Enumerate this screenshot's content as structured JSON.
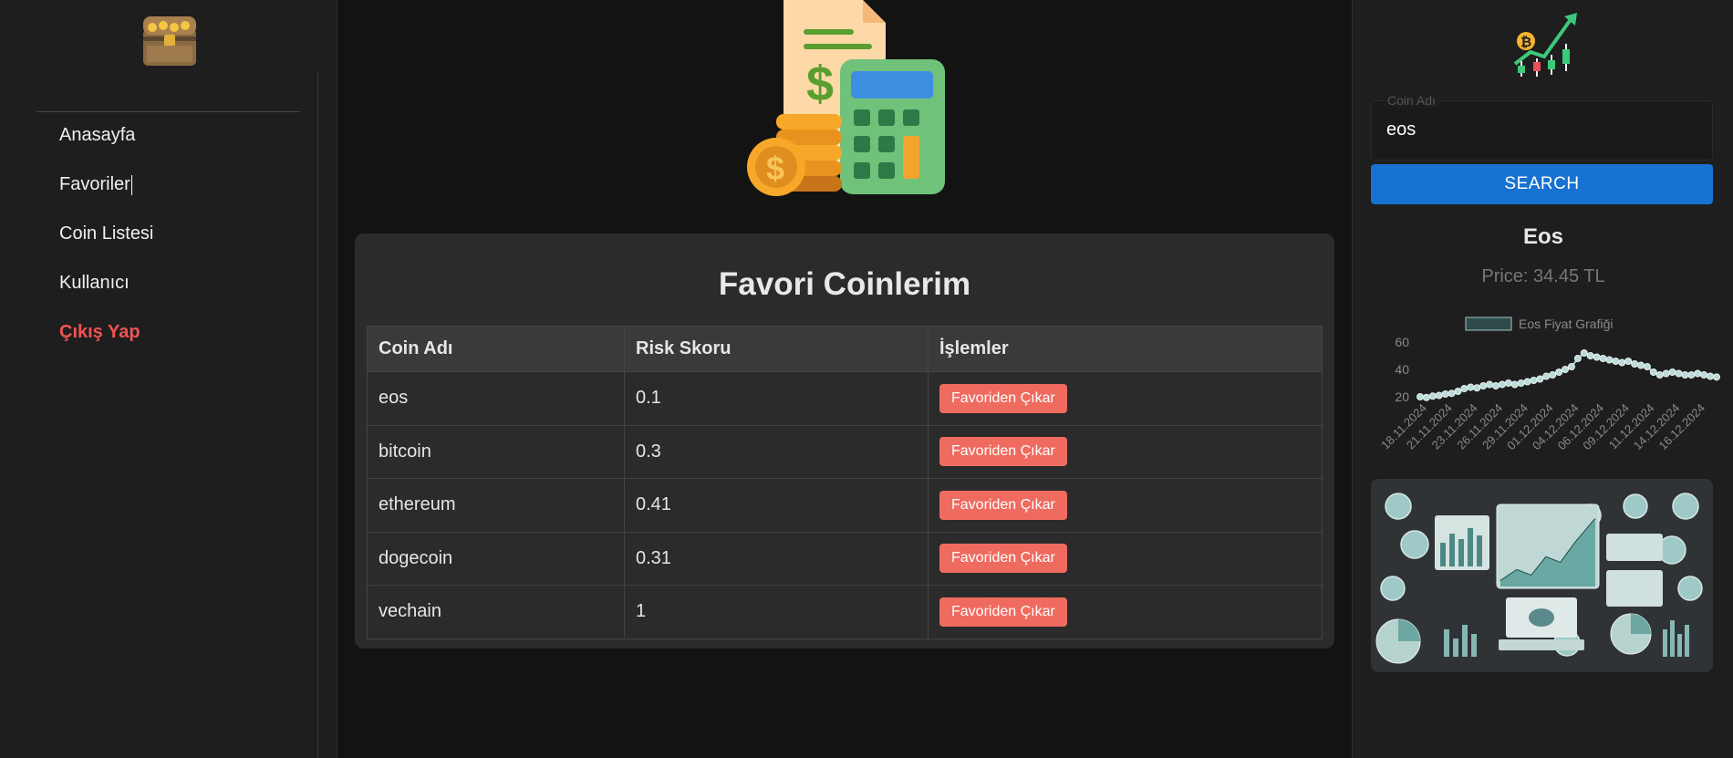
{
  "sidebar": {
    "logo_icon": "treasure-chest-icon",
    "items": [
      {
        "label": "Anasayfa"
      },
      {
        "label": "Favoriler"
      },
      {
        "label": "Coin Listesi"
      },
      {
        "label": "Kullanıcı"
      },
      {
        "label": "Çıkış Yap",
        "color": "#f05353"
      }
    ]
  },
  "main": {
    "hero_icon": "bill-calculator-coins-icon",
    "title": "Favori Coinlerim",
    "table": {
      "headers": [
        "Coin Adı",
        "Risk Skoru",
        "İşlemler"
      ],
      "rows": [
        {
          "coin": "eos",
          "risk": "0.1",
          "action": "Favoriden Çıkar"
        },
        {
          "coin": "bitcoin",
          "risk": "0.3",
          "action": "Favoriden Çıkar"
        },
        {
          "coin": "ethereum",
          "risk": "0.41",
          "action": "Favoriden Çıkar"
        },
        {
          "coin": "dogecoin",
          "risk": "0.31",
          "action": "Favoriden Çıkar"
        },
        {
          "coin": "vechain",
          "risk": "1",
          "action": "Favoriden Çıkar"
        }
      ]
    },
    "accent_button": "#f06b5f"
  },
  "right": {
    "logo_icon": "crypto-chart-icon",
    "search": {
      "legend": "Coin Adı",
      "value": "eos",
      "button": "SEARCH"
    },
    "coin_name": "Eos",
    "price": "Price: 34.45 TL",
    "dashboard_icon": "crypto-dashboard-illustration",
    "accent": "#1872d2"
  },
  "chart_data": {
    "type": "line",
    "title": "",
    "legend": "Eos Fiyat Grafiği",
    "ylim": [
      20,
      60
    ],
    "yticks": [
      20,
      40,
      60
    ],
    "xticks": [
      "18.11.2024",
      "21.11.2024",
      "23.11.2024",
      "26.11.2024",
      "29.11.2024",
      "01.12.2024",
      "04.12.2024",
      "06.12.2024",
      "09.12.2024",
      "11.12.2024",
      "14.12.2024",
      "16.12.2024"
    ],
    "series": [
      {
        "name": "Eos Fiyat Grafiği",
        "values": [
          20,
          19.5,
          20.5,
          21,
          22,
          22.5,
          24,
          26,
          27,
          26.5,
          28,
          29,
          28,
          29,
          30,
          29,
          30,
          31,
          32,
          33,
          35,
          36,
          38,
          40,
          42,
          48,
          52,
          50,
          49,
          48,
          47,
          46,
          45,
          46,
          44,
          43,
          42,
          38,
          36,
          37,
          38,
          37,
          36,
          36,
          37,
          36,
          35,
          34.45
        ]
      }
    ]
  }
}
